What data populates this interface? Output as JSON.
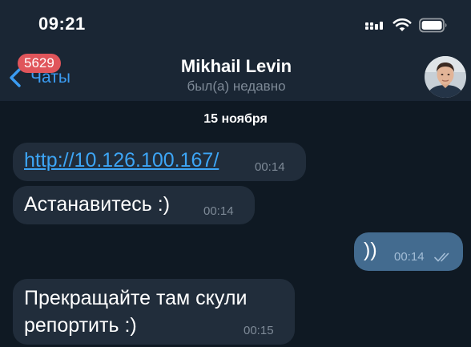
{
  "status_bar": {
    "time": "09:21",
    "icons": [
      "cellular-signal-icon",
      "wifi-icon",
      "battery-icon"
    ]
  },
  "nav": {
    "back_label": "Чаты",
    "unread_count": "5629",
    "title": "Mikhail Levin",
    "subtitle": "был(а) недавно"
  },
  "chat": {
    "date_separator": "15 ноября",
    "messages": [
      {
        "direction": "incoming",
        "text": "http://10.126.100.167/",
        "is_link": true,
        "time": "00:14"
      },
      {
        "direction": "incoming",
        "text": "Астанавитесь :)",
        "time": "00:14"
      },
      {
        "direction": "outgoing",
        "text": "))",
        "time": "00:14",
        "status": "read"
      },
      {
        "direction": "incoming",
        "lines": [
          "Прекращайте там скули",
          "репортить :)"
        ],
        "time": "00:15"
      }
    ]
  },
  "colors": {
    "background": "#0f1923",
    "header": "#1a2634",
    "incoming_bubble": "#212d3b",
    "outgoing_bubble": "#436b8f",
    "accent": "#3b9cf2",
    "badge": "#e0555b"
  }
}
